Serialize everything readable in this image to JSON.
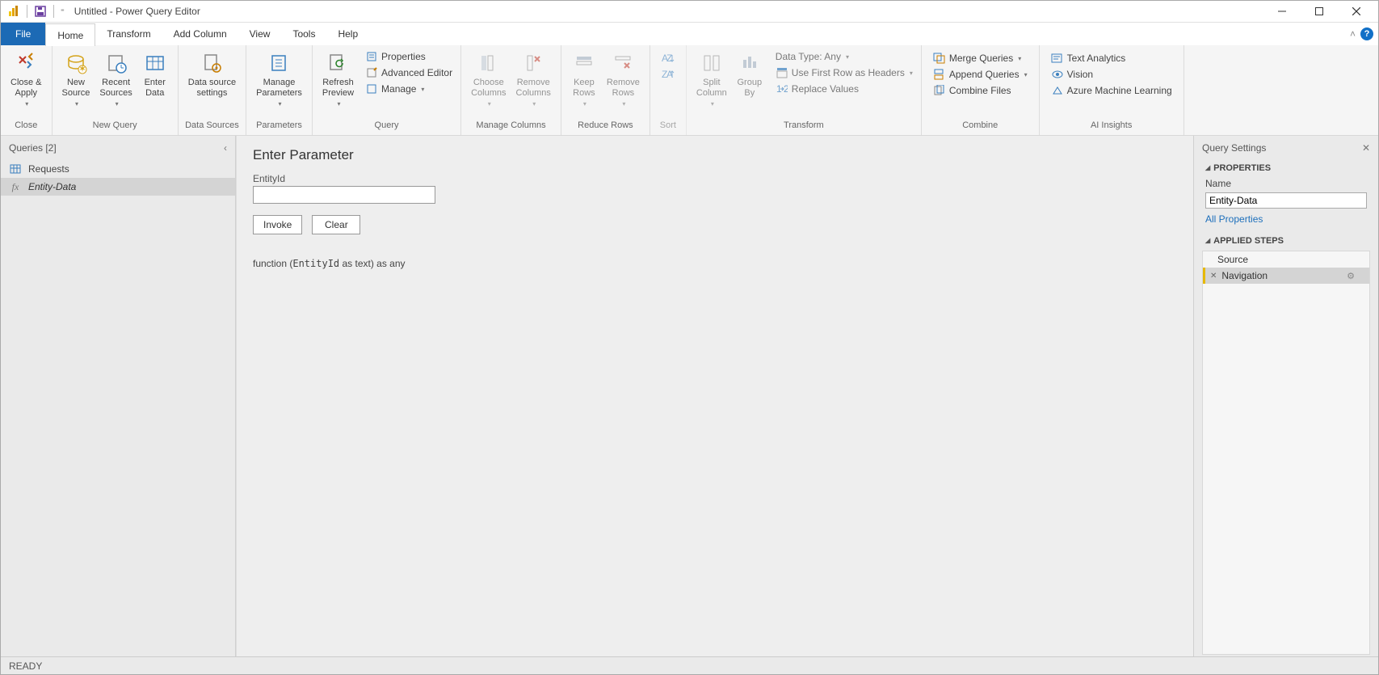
{
  "title": "Untitled - Power Query Editor",
  "menu": {
    "file": "File",
    "home": "Home",
    "transform": "Transform",
    "addcolumn": "Add Column",
    "view": "View",
    "tools": "Tools",
    "help": "Help"
  },
  "ribbon": {
    "close": {
      "close_apply": "Close &\nApply",
      "group": "Close"
    },
    "newquery": {
      "new_source": "New\nSource",
      "recent_sources": "Recent\nSources",
      "enter_data": "Enter\nData",
      "group": "New Query"
    },
    "datasources": {
      "ds_settings": "Data source\nsettings",
      "group": "Data Sources"
    },
    "parameters": {
      "manage_params": "Manage\nParameters",
      "group": "Parameters"
    },
    "query": {
      "refresh": "Refresh\nPreview",
      "properties": "Properties",
      "advanced": "Advanced Editor",
      "manage": "Manage",
      "group": "Query"
    },
    "managecols": {
      "choose": "Choose\nColumns",
      "remove": "Remove\nColumns",
      "group": "Manage Columns"
    },
    "reducerows": {
      "keep": "Keep\nRows",
      "remove": "Remove\nRows",
      "group": "Reduce Rows"
    },
    "sort": {
      "group": "Sort"
    },
    "transform": {
      "split": "Split\nColumn",
      "groupby": "Group\nBy",
      "datatype": "Data Type: Any",
      "firstrow": "Use First Row as Headers",
      "replace": "Replace Values",
      "group": "Transform"
    },
    "combine": {
      "merge": "Merge Queries",
      "append": "Append Queries",
      "combinefiles": "Combine Files",
      "group": "Combine"
    },
    "ai": {
      "text": "Text Analytics",
      "vision": "Vision",
      "aml": "Azure Machine Learning",
      "group": "AI Insights"
    }
  },
  "queries": {
    "header": "Queries [2]",
    "items": [
      "Requests",
      "Entity-Data"
    ]
  },
  "main": {
    "heading": "Enter Parameter",
    "param_label": "EntityId",
    "invoke": "Invoke",
    "clear": "Clear",
    "sig_prefix": "function (",
    "sig_param": "EntityId",
    "sig_mid": " as text) as any"
  },
  "settings": {
    "header": "Query Settings",
    "properties": "PROPERTIES",
    "name_label": "Name",
    "name_value": "Entity-Data",
    "all_props": "All Properties",
    "applied": "APPLIED STEPS",
    "steps": [
      "Source",
      "Navigation"
    ]
  },
  "status": "READY"
}
